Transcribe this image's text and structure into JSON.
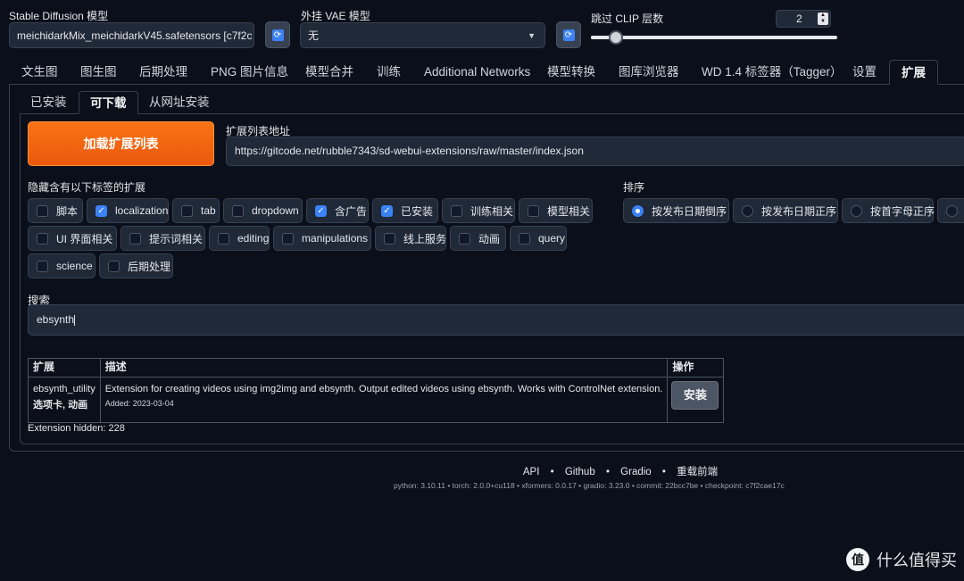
{
  "model_bar": {
    "sd_model_label": "Stable Diffusion 模型",
    "sd_model_value": "meichidarkMix_meichidarkV45.safetensors [c7f2c",
    "vae_label": "外挂 VAE 模型",
    "vae_value": "无",
    "clip_label": "跳过 CLIP 层数",
    "clip_value": "2",
    "clip_slider_fraction": 0.1,
    "refresh_icon": "refresh-icon"
  },
  "main_tabs": [
    "文生图",
    "图生图",
    "后期处理",
    "PNG 图片信息",
    "模型合并",
    "训练",
    "Additional Networks",
    "模型转换",
    "图库浏览器",
    "WD 1.4 标签器（Tagger）",
    "设置",
    "扩展"
  ],
  "sub_tabs": [
    "已安装",
    "可下载",
    "从网址安装"
  ],
  "load_button": "加载扩展列表",
  "ext_url": {
    "label": "扩展列表地址",
    "value": "https://gitcode.net/rubble7343/sd-webui-extensions/raw/master/index.json"
  },
  "hide_tags": {
    "label": "隐藏含有以下标签的扩展",
    "items": [
      {
        "label": "脚本",
        "checked": false
      },
      {
        "label": "localization",
        "checked": true
      },
      {
        "label": "tab",
        "checked": false
      },
      {
        "label": "dropdown",
        "checked": false
      },
      {
        "label": "含广告",
        "checked": true
      },
      {
        "label": "已安装",
        "checked": true
      },
      {
        "label": "训练相关",
        "checked": false
      },
      {
        "label": "模型相关",
        "checked": false
      },
      {
        "label": "UI 界面相关",
        "checked": false
      },
      {
        "label": "提示词相关",
        "checked": false
      },
      {
        "label": "editing",
        "checked": false
      },
      {
        "label": "manipulations",
        "checked": false
      },
      {
        "label": "线上服务",
        "checked": false
      },
      {
        "label": "动画",
        "checked": false
      },
      {
        "label": "query",
        "checked": false
      },
      {
        "label": "science",
        "checked": false
      },
      {
        "label": "后期处理",
        "checked": false
      }
    ]
  },
  "sort": {
    "label": "排序",
    "options": [
      {
        "label": "按发布日期倒序",
        "selected": true
      },
      {
        "label": "按发布日期正序",
        "selected": false
      },
      {
        "label": "按首字母正序",
        "selected": false
      }
    ]
  },
  "search": {
    "label": "搜索",
    "value": "ebsynth"
  },
  "table": {
    "headers": [
      "扩展",
      "描述",
      "操作"
    ],
    "rows": [
      {
        "name": "ebsynth_utility",
        "tags": "选项卡, 动画",
        "description": "Extension for creating videos using img2img and ebsynth. Output edited videos using ebsynth. Works with ControlNet extension.",
        "added": "Added: 2023-03-04",
        "action": "安装"
      }
    ]
  },
  "hidden_count": "Extension hidden: 228",
  "footer": {
    "links": [
      "API",
      "Github",
      "Gradio",
      "重载前端"
    ],
    "separator": "•",
    "versions": "python: 3.10.11  •  torch: 2.0.0+cu118  •  xformers: 0.0.17  •  gradio: 3.23.0  •  commit: 22bcc7be  •  checkpoint: c7f2cae17c"
  },
  "watermark": {
    "icon": "值",
    "text": "什么值得买"
  },
  "colors": {
    "background": "#0b0f19",
    "accent_orange": "#ea580c",
    "checkbox_blue": "#3b82f6"
  }
}
